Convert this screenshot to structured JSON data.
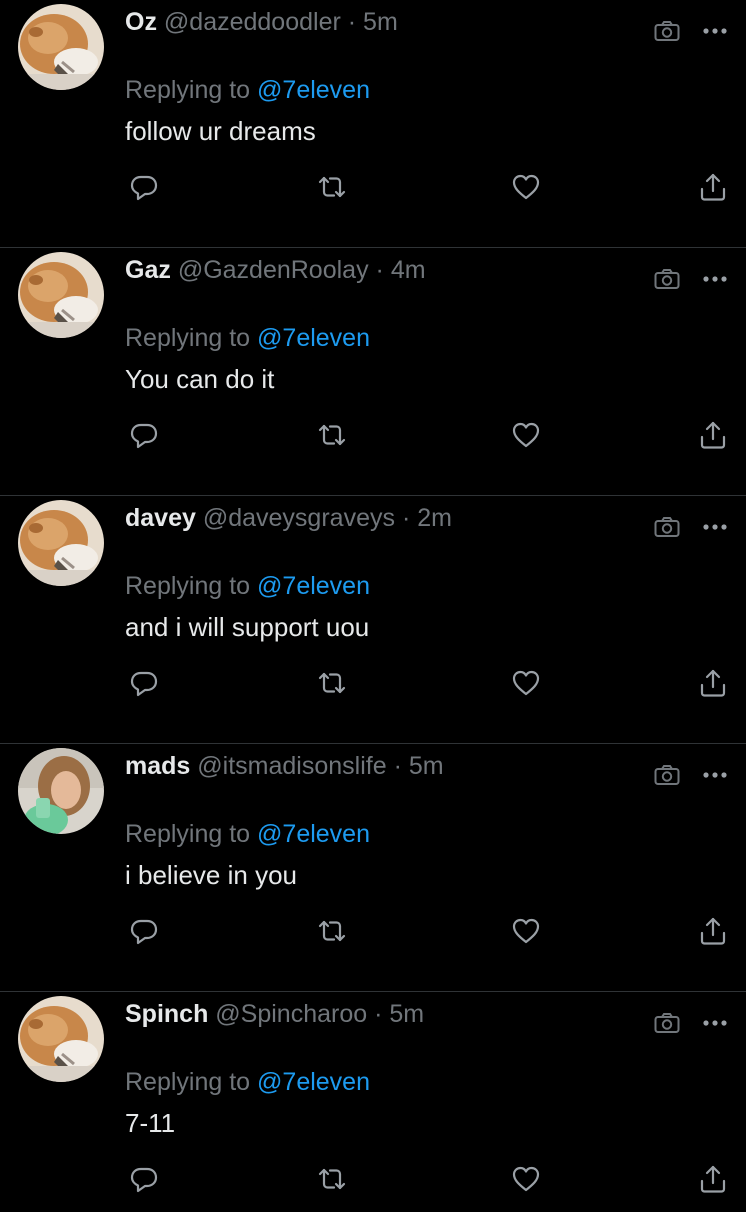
{
  "colors": {
    "background": "#000000",
    "text": "#e7e9ea",
    "muted": "#71767b",
    "link": "#1d9bf0",
    "divider": "#2f3336"
  },
  "replying_label": "Replying to",
  "tweets": [
    {
      "name": "Oz",
      "handle": "@dazeddoodler",
      "separator": "·",
      "time": "5m",
      "mention": "@7eleven",
      "text": "follow ur dreams",
      "avatar": "cat-avatar"
    },
    {
      "name": "Gaz",
      "handle": "@GazdenRoolay",
      "separator": "·",
      "time": "4m",
      "mention": "@7eleven",
      "text": "You can do it",
      "avatar": "cat-avatar"
    },
    {
      "name": "davey",
      "handle": "@daveysgraveys",
      "separator": "·",
      "time": "2m",
      "mention": "@7eleven",
      "text": "and i will support uou",
      "avatar": "cat-avatar"
    },
    {
      "name": "mads",
      "handle": "@itsmadisonslife",
      "separator": "·",
      "time": "5m",
      "mention": "@7eleven",
      "text": "i believe in you",
      "avatar": "person-avatar"
    },
    {
      "name": "Spinch",
      "handle": "@Spincharoo",
      "separator": "·",
      "time": "5m",
      "mention": "@7eleven",
      "text": "7-11",
      "avatar": "cat-avatar"
    }
  ],
  "icons": {
    "top": [
      "camera-icon",
      "more-icon"
    ],
    "actions": [
      "reply-icon",
      "retweet-icon",
      "like-icon",
      "share-icon"
    ]
  }
}
